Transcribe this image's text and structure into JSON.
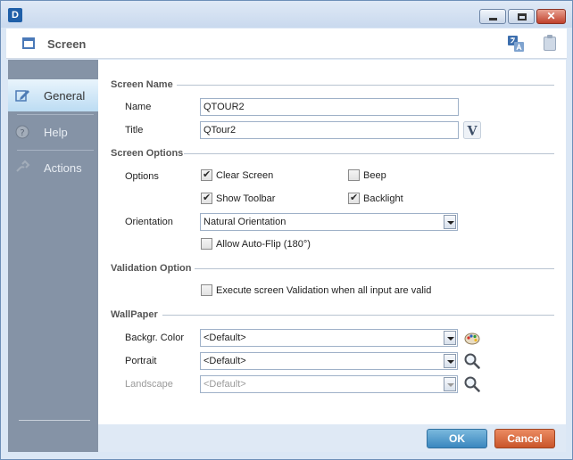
{
  "window": {
    "app_icon_text": "D",
    "controls": {
      "minimize": "minimize",
      "maximize": "maximize",
      "close_glyph": "✕"
    }
  },
  "header": {
    "title": "Screen",
    "icons": [
      "screen-icon",
      "translate-icon",
      "clipboard-icon"
    ]
  },
  "sidebar": {
    "items": [
      {
        "label": "General",
        "icon": "edit-icon",
        "active": true
      },
      {
        "label": "Help",
        "icon": "help-icon",
        "active": false
      },
      {
        "label": "Actions",
        "icon": "link-icon",
        "active": false
      }
    ]
  },
  "screen_name": {
    "section": "Screen Name",
    "name_label": "Name",
    "name_value": "QTOUR2",
    "title_label": "Title",
    "title_value": "QTour2",
    "title_button_glyph": "V"
  },
  "screen_options": {
    "section": "Screen Options",
    "options_label": "Options",
    "clear_screen": {
      "label": "Clear Screen",
      "checked": true
    },
    "beep": {
      "label": "Beep",
      "checked": false
    },
    "show_toolbar": {
      "label": "Show Toolbar",
      "checked": true
    },
    "backlight": {
      "label": "Backlight",
      "checked": true
    },
    "orientation_label": "Orientation",
    "orientation_value": "Natural Orientation",
    "auto_flip": {
      "label": "Allow Auto-Flip (180°)",
      "checked": false
    }
  },
  "validation": {
    "section": "Validation Option",
    "execute": {
      "label": "Execute screen Validation when all input are valid",
      "checked": false
    }
  },
  "wallpaper": {
    "section": "WallPaper",
    "backgr_label": "Backgr. Color",
    "backgr_value": "<Default>",
    "portrait_label": "Portrait",
    "portrait_value": "<Default>",
    "landscape_label": "Landscape",
    "landscape_value": "<Default>"
  },
  "footer": {
    "ok_label": "OK",
    "cancel_label": "Cancel"
  },
  "colors": {
    "sidebar_bg": "#8593a6",
    "active_tab": "#bcdcf3",
    "ok_button": "#3a87bf",
    "cancel_button": "#c9552a"
  }
}
